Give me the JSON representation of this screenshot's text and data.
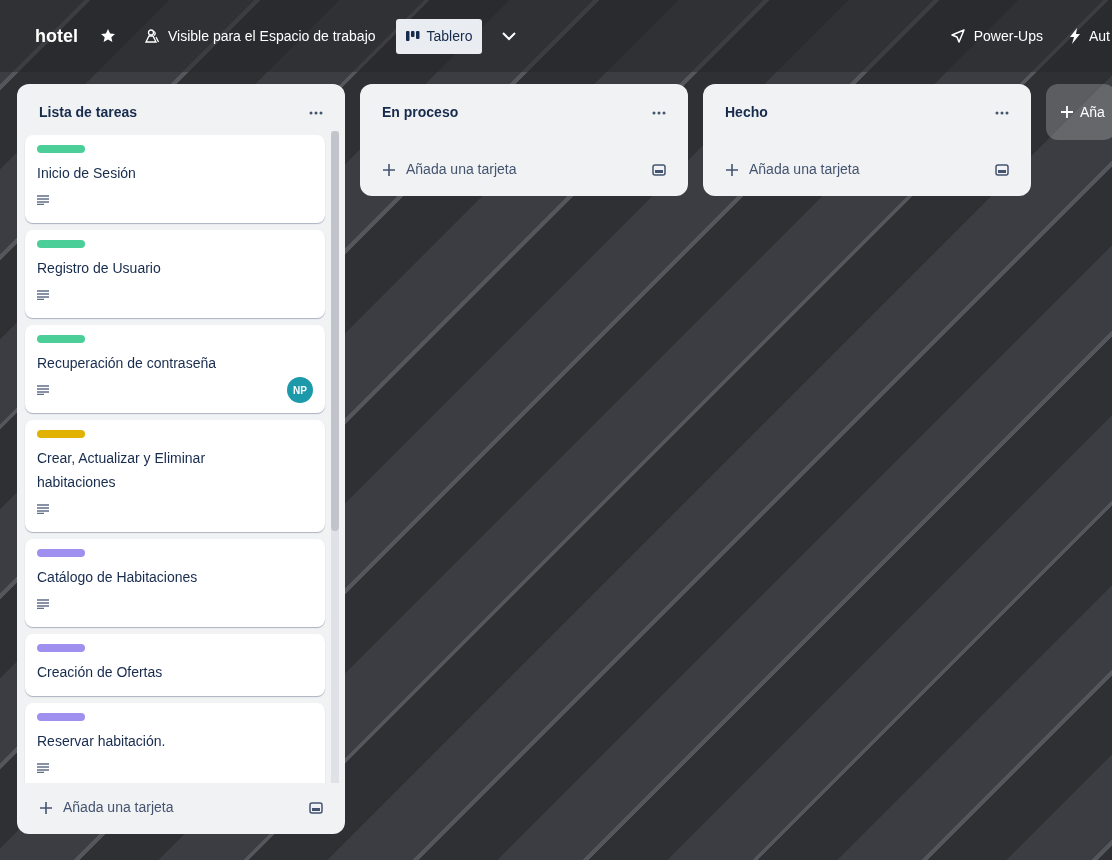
{
  "board": {
    "title": "hotel",
    "starred": true,
    "visibility": "Visible para el Espacio de trabajo",
    "view": "Tablero",
    "actions": [
      {
        "kind": "powerups",
        "label": "Power-Ups"
      },
      {
        "kind": "automation",
        "label": "Aut"
      }
    ]
  },
  "lists": [
    {
      "title": "Lista de tareas",
      "cards": [
        {
          "color": "#4bce97",
          "title": "Inicio de Sesión",
          "description": true
        },
        {
          "color": "#4bce97",
          "title": "Registro de Usuario",
          "description": true
        },
        {
          "color": "#4bce97",
          "title": "Recuperación de contraseña",
          "description": true,
          "members": [
            {
              "initials": "NP",
              "color": "#1d9aaa"
            }
          ]
        },
        {
          "color": "#e2b203",
          "title": "Crear, Actualizar y Eliminar habitaciones",
          "description": true
        },
        {
          "color": "#9f8fef",
          "title": "Catálogo de Habitaciones",
          "description": true
        },
        {
          "color": "#9f8fef",
          "title": "Creación de Ofertas",
          "description": false
        },
        {
          "color": "#9f8fef",
          "title": "Reservar habitación.",
          "description": true
        }
      ],
      "add_card": "Añada una tarjeta"
    },
    {
      "title": "En proceso",
      "add_card": "Añada una tarjeta"
    },
    {
      "title": "Hecho",
      "add_card": "Añada una tarjeta"
    }
  ],
  "add_list": "Aña"
}
